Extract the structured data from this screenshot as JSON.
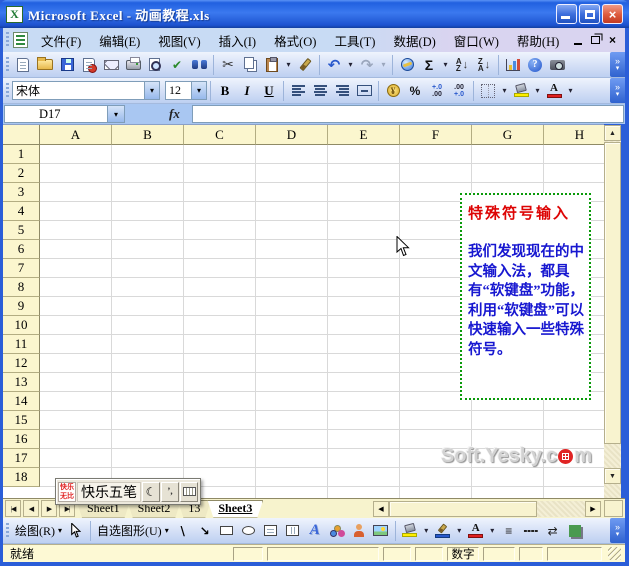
{
  "titlebar": {
    "app_icon_letter": "X",
    "title": "Microsoft Excel - 动画教程.xls",
    "close_glyph": "×"
  },
  "menubar": {
    "items": [
      "文件(F)",
      "编辑(E)",
      "视图(V)",
      "插入(I)",
      "格式(O)",
      "工具(T)",
      "数据(D)",
      "窗口(W)",
      "帮助(H)"
    ],
    "close_glyph": "×"
  },
  "std_toolbar": {
    "spell_glyph": "✔",
    "cut_glyph": "✂",
    "undo_glyph": "↶",
    "redo_glyph": "↷",
    "sum_glyph": "Σ",
    "sort_a": "A",
    "sort_z": "Z",
    "sort_arrow": "↓",
    "help_glyph": "?",
    "dropdown_glyph": "▾",
    "overflow_glyph": "»",
    "overflow_more": "▾"
  },
  "fmt_toolbar": {
    "font_name": "宋体",
    "font_size": "12",
    "bold": "B",
    "italic": "I",
    "underline": "U",
    "currency_glyph": "¥",
    "percent_glyph": "%",
    "inc_decimal_top": "+.0",
    "inc_decimal_bottom": ".00",
    "dec_decimal_top": ".00",
    "dec_decimal_bottom": "+.0",
    "font_color_letter": "A",
    "dropdown_glyph": "▾",
    "overflow_glyph": "»",
    "overflow_more": "▾"
  },
  "formula_bar": {
    "name_box": "D17",
    "fx_label": "fx",
    "formula_value": "",
    "dropdown_glyph": "▾"
  },
  "grid": {
    "columns": [
      "A",
      "B",
      "C",
      "D",
      "E",
      "F",
      "G",
      "H"
    ],
    "rows": [
      "1",
      "2",
      "3",
      "4",
      "5",
      "6",
      "7",
      "8",
      "9",
      "10",
      "11",
      "12",
      "13",
      "14",
      "15",
      "16",
      "17",
      "18"
    ],
    "scroll_up": "▲",
    "scroll_down": "▼"
  },
  "note_box": {
    "title": "特殊符号输入",
    "body": "我们发现现在的中文输入法，都具有“软键盘”功能，利用“软键盘”可以快速输入一些特殊符号。"
  },
  "watermark": {
    "text_before": "Soft.Yesky.c",
    "text_after": "m"
  },
  "ime_bar": {
    "logo_top": "快乐",
    "logo_bottom": "无比",
    "ime_name": "快乐五笔",
    "moon_glyph": "☾",
    "punct_glyph": "’,"
  },
  "sheet_bar": {
    "nav_first": "|◀",
    "nav_prev": "◀",
    "nav_next": "▶",
    "nav_last": "▶|",
    "tabs": [
      {
        "label": "Sheet1",
        "active": false
      },
      {
        "label": "Sheet2",
        "active": false
      },
      {
        "label": "13",
        "active": false
      },
      {
        "label": "Sheet3",
        "active": true
      }
    ],
    "hscroll_left": "◀",
    "hscroll_right": "▶"
  },
  "drawing_toolbar": {
    "draw_label": "绘图(R)",
    "autoshapes_label": "自选图形(U)",
    "line_glyph": "\\",
    "arrow_glyph": "↘",
    "wordart_letter": "A",
    "font_color_letter": "A",
    "line_style_glyph": "≡",
    "dash_style_glyph": "╍╍",
    "arrow_style_glyph": "⇄",
    "dropdown_glyph": "▾",
    "overflow_glyph": "»",
    "overflow_more": "▾"
  },
  "status_bar": {
    "ready": "就绪",
    "num_indicator": "数字"
  },
  "icons": {
    "excel-app-icon": "css-shape",
    "new-document-icon": "css-shape",
    "open-folder-icon": "css-shape",
    "save-icon": "css-shape",
    "permission-icon": "css-shape",
    "email-icon": "css-shape",
    "print-icon": "css-shape",
    "print-preview-icon": "css-shape",
    "spelling-icon": "✔",
    "find-icon": "css-shape",
    "cut-icon": "✂",
    "copy-icon": "css-shape",
    "paste-icon": "css-shape",
    "format-painter-icon": "css-shape",
    "undo-icon": "↶",
    "redo-icon": "↷",
    "hyperlink-icon": "css-shape",
    "autosum-icon": "Σ",
    "sort-ascending-icon": "AZ↓",
    "sort-descending-icon": "ZA↓",
    "chart-wizard-icon": "css-shape",
    "help-icon": "?",
    "camera-icon": "css-shape",
    "borders-icon": "css-shape",
    "fill-color-icon": "css-shape",
    "font-color-icon": "A-red",
    "moon-icon": "☾",
    "keyboard-icon": "css-shape",
    "select-arrow-icon": "svg-shape",
    "mouse-cursor": "svg-shape",
    "shadow-style-icon": "css-shape"
  }
}
